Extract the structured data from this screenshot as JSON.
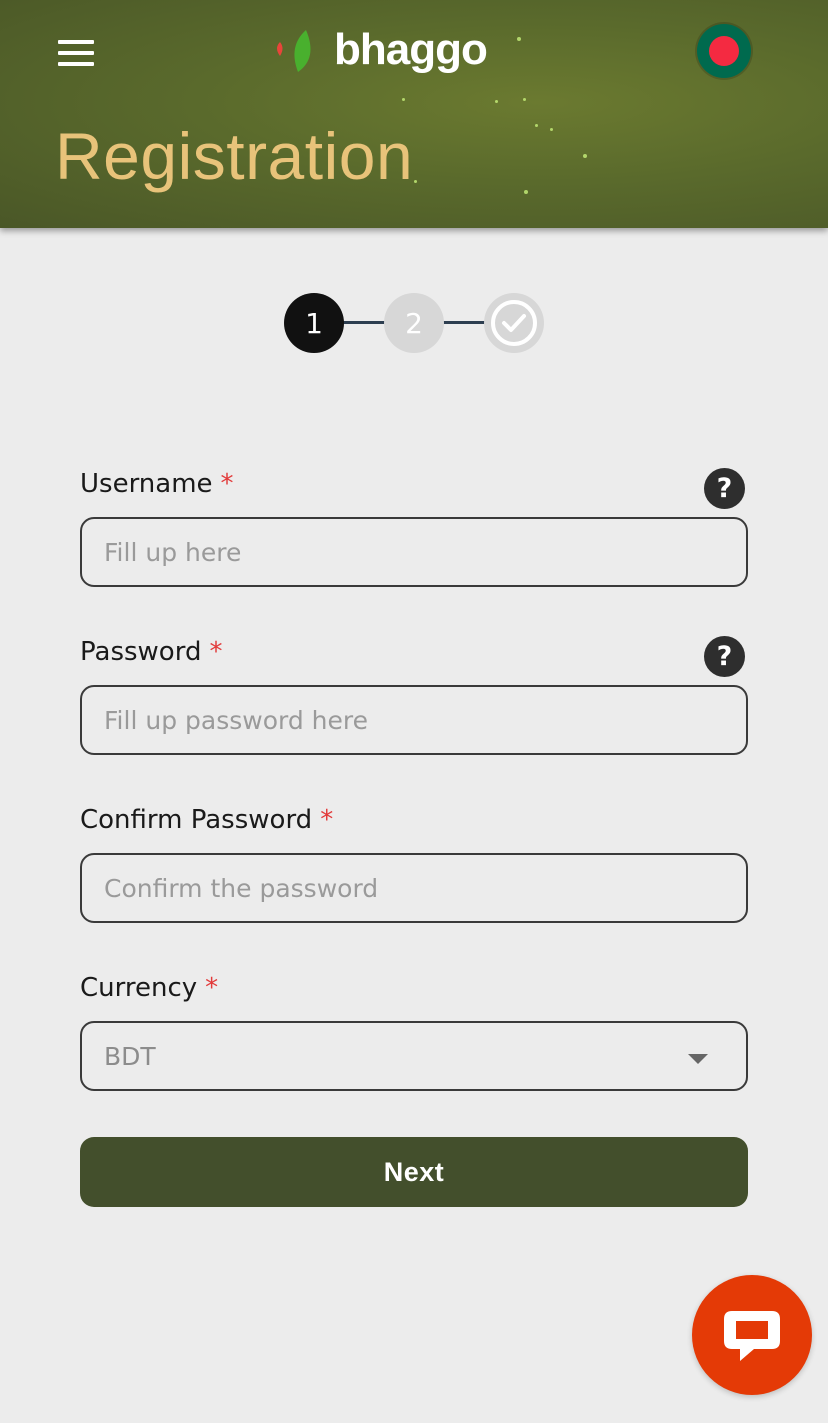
{
  "header": {
    "brand_name": "bhaggo",
    "page_title": "Registration",
    "menu_icon": "hamburger-menu-icon",
    "language_flag": "bangladesh-flag-icon"
  },
  "stepper": {
    "steps": [
      {
        "label": "1",
        "state": "active"
      },
      {
        "label": "2",
        "state": "inactive"
      },
      {
        "label": "",
        "icon": "checkmark-icon",
        "state": "inactive"
      }
    ]
  },
  "form": {
    "required_marker": "*",
    "username": {
      "label": "Username",
      "placeholder": "Fill up here",
      "value": "",
      "help": "?"
    },
    "password": {
      "label": "Password",
      "placeholder": "Fill up password here",
      "value": "",
      "help": "?"
    },
    "confirm_password": {
      "label": "Confirm Password",
      "placeholder": "Confirm the password",
      "value": ""
    },
    "currency": {
      "label": "Currency",
      "selected": "BDT"
    },
    "next_label": "Next"
  },
  "chat": {
    "icon": "chat-bubble-icon"
  },
  "colors": {
    "header_green": "#5a6a2c",
    "title_gold": "#e8c37a",
    "button_green": "#434f2c",
    "chat_orange": "#e43a06",
    "required_red": "#e23a3a"
  }
}
